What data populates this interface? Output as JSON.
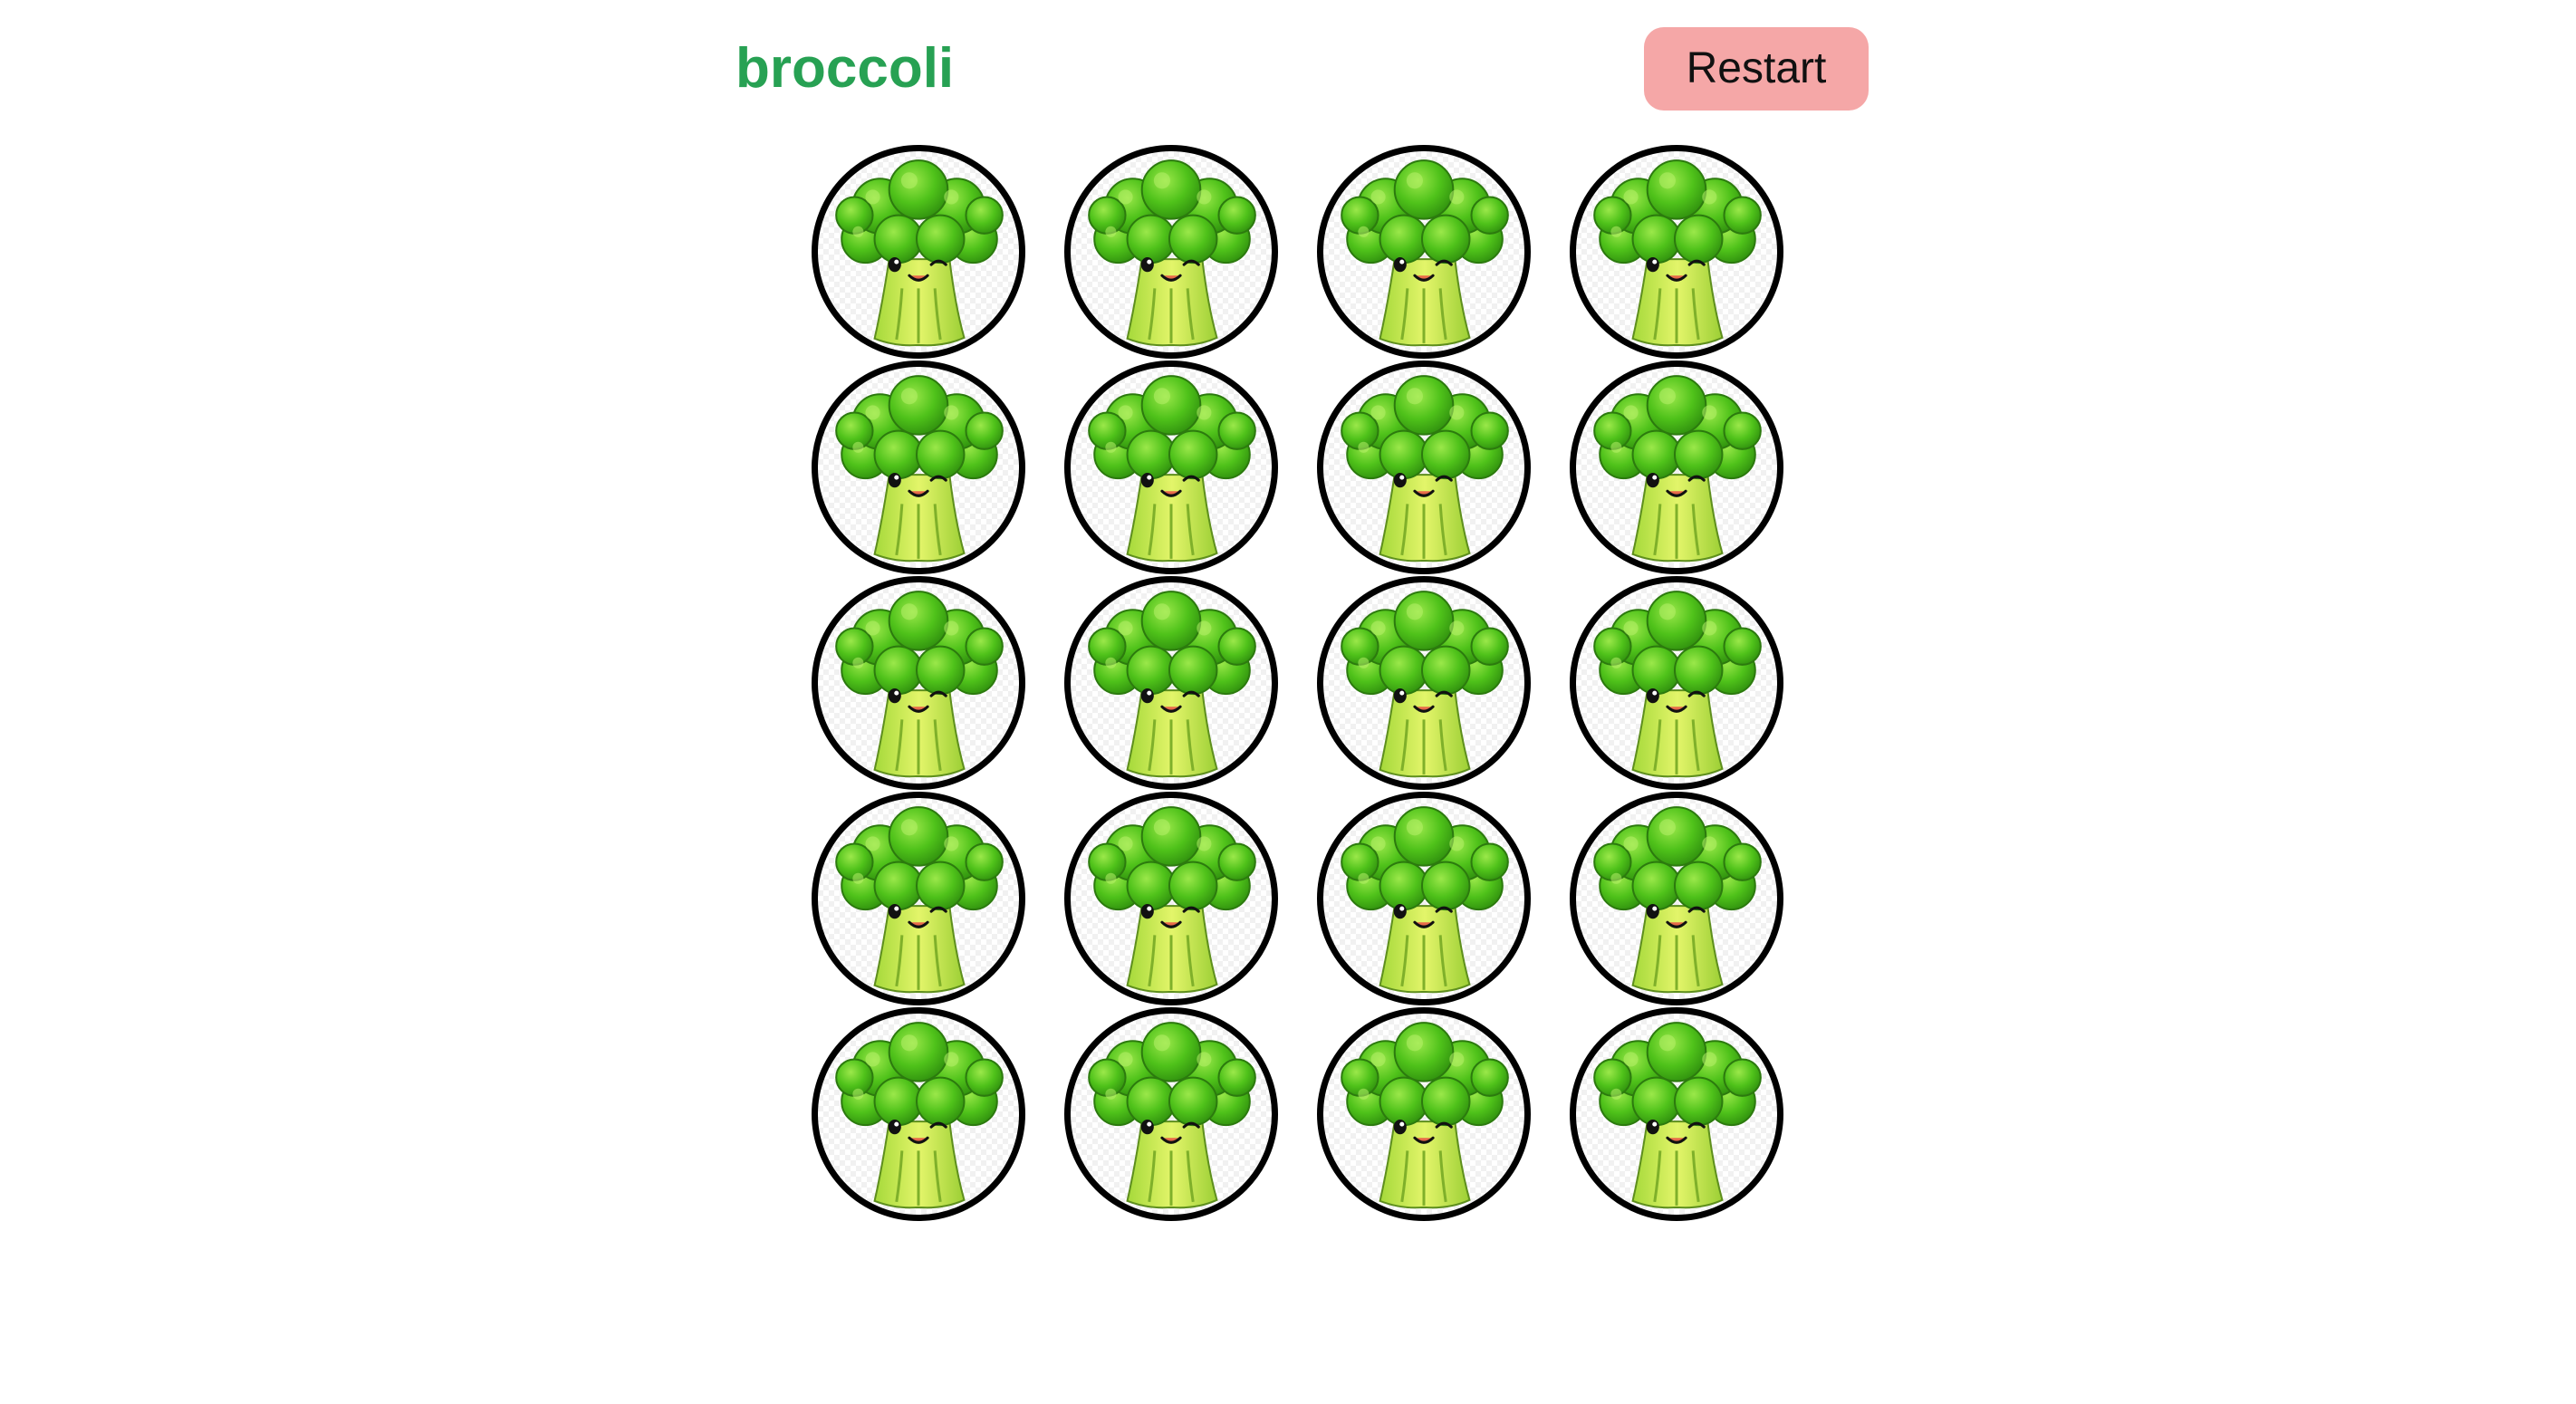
{
  "header": {
    "title": "broccoli",
    "restart_label": "Restart"
  },
  "board": {
    "rows": 5,
    "columns": 4,
    "tiles": [
      {
        "icon": "broccoli-icon"
      },
      {
        "icon": "broccoli-icon"
      },
      {
        "icon": "broccoli-icon"
      },
      {
        "icon": "broccoli-icon"
      },
      {
        "icon": "broccoli-icon"
      },
      {
        "icon": "broccoli-icon"
      },
      {
        "icon": "broccoli-icon"
      },
      {
        "icon": "broccoli-icon"
      },
      {
        "icon": "broccoli-icon"
      },
      {
        "icon": "broccoli-icon"
      },
      {
        "icon": "broccoli-icon"
      },
      {
        "icon": "broccoli-icon"
      },
      {
        "icon": "broccoli-icon"
      },
      {
        "icon": "broccoli-icon"
      },
      {
        "icon": "broccoli-icon"
      },
      {
        "icon": "broccoli-icon"
      },
      {
        "icon": "broccoli-icon"
      },
      {
        "icon": "broccoli-icon"
      },
      {
        "icon": "broccoli-icon"
      },
      {
        "icon": "broccoli-icon"
      }
    ]
  },
  "colors": {
    "title": "#27a153",
    "restart_background": "#f5a7a7",
    "tile_border": "#000000",
    "floret": "#4fc21a",
    "floret_highlight": "#8fe63a",
    "stem": "#bde84a"
  }
}
